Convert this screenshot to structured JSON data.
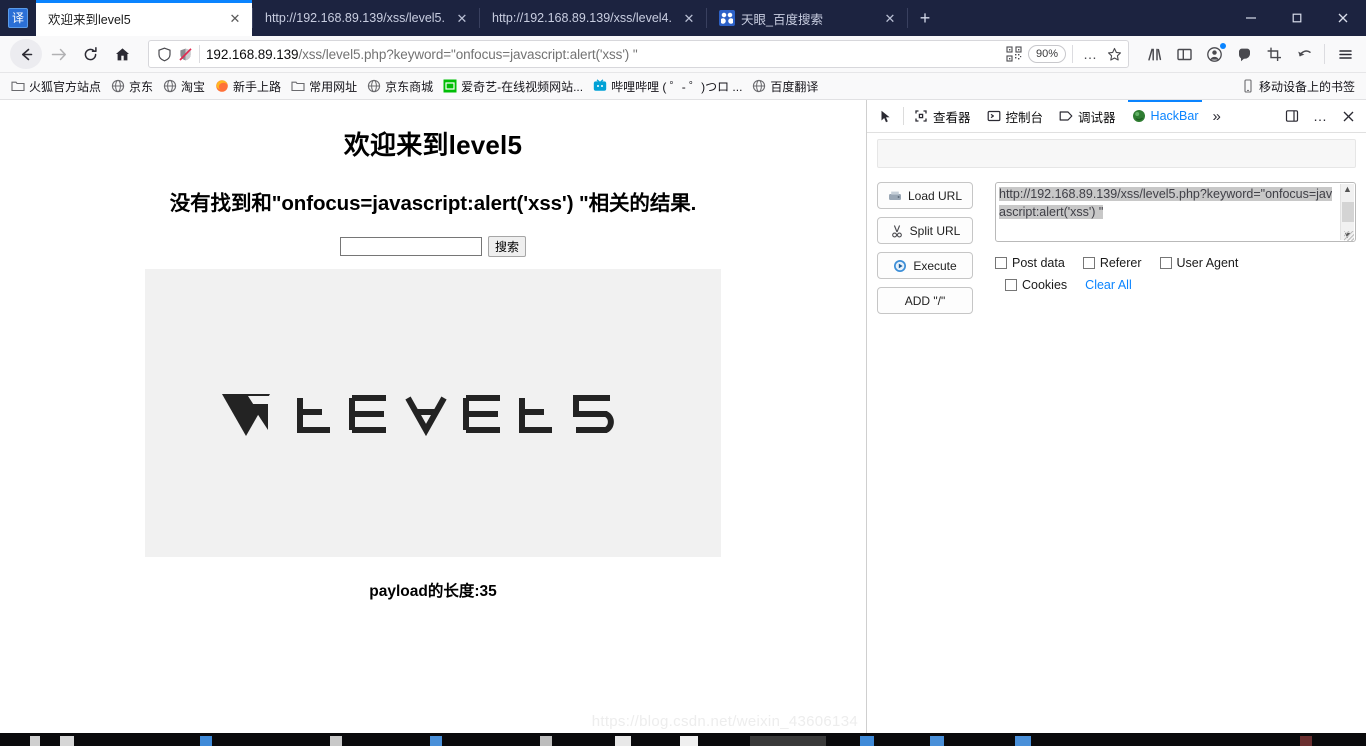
{
  "window": {
    "translate_badge": "译",
    "tabs": [
      {
        "title": "欢迎来到level5",
        "favicon": "none",
        "active": true,
        "close": "✕"
      },
      {
        "title": "http://192.168.89.139/xss/level5.",
        "favicon": "none",
        "active": false,
        "close": "✕"
      },
      {
        "title": "http://192.168.89.139/xss/level4.",
        "favicon": "none",
        "active": false,
        "close": "✕"
      },
      {
        "title": "天眼_百度搜索",
        "favicon": "baidu",
        "active": false,
        "close": "✕"
      }
    ],
    "newtab_label": "+",
    "controls": {
      "minimize": "—",
      "maximize": "❐",
      "close": "✕"
    }
  },
  "nav": {
    "back": "←",
    "forward": "→",
    "reload": "⟳",
    "home": "⌂",
    "url_host": "192.168.89.139",
    "url_path": "/xss/level5.php?keyword=\"onfocus=javascript:alert('xss') \"",
    "zoom_level": "90%",
    "shield_icon": "shield-icon",
    "permission_icon": "blocked-permission-icon",
    "qr_icon": "qr-code-icon",
    "more_icon": "…",
    "star_icon": "☆",
    "library_icon": "library-icon",
    "sidebar_icon": "sidebar-icon",
    "account_icon": "account-icon",
    "pocket_icon": "pocket-icon",
    "screenshot_icon": "screenshot-icon",
    "undo_icon": "↰",
    "menu_icon": "☰"
  },
  "bookmarks": {
    "items": [
      {
        "label": "火狐官方站点",
        "icon": "folder"
      },
      {
        "label": "京东",
        "icon": "globe"
      },
      {
        "label": "淘宝",
        "icon": "globe"
      },
      {
        "label": "新手上路",
        "icon": "firefox"
      },
      {
        "label": "常用网址",
        "icon": "folder"
      },
      {
        "label": "京东商城",
        "icon": "globe"
      },
      {
        "label": "爱奇艺-在线视频网站...",
        "icon": "iqiyi"
      },
      {
        "label": "哔哩哔哩 ( ゜- ゜)つロ ...",
        "icon": "bilibili"
      },
      {
        "label": "百度翻译",
        "icon": "globe"
      }
    ],
    "mobile": {
      "label": "移动设备上的书签",
      "icon": "phone"
    }
  },
  "page": {
    "heading": "欢迎来到level5",
    "subheading": "没有找到和\"onfocus=javascript:alert('xss') \"相关的结果.",
    "search_value": "",
    "search_placeholder": "",
    "search_button": "搜索",
    "logo_text": "LEVEL5",
    "payload_text": "payload的长度:35",
    "watermark": "https://blog.csdn.net/weixin_43606134"
  },
  "devtools": {
    "inspector_picker_icon": "element-picker-icon",
    "tabs": [
      {
        "label": "查看器",
        "icon": "inspector-icon",
        "active": false
      },
      {
        "label": "控制台",
        "icon": "console-icon",
        "active": false
      },
      {
        "label": "调试器",
        "icon": "debugger-icon",
        "active": false
      },
      {
        "label": "HackBar",
        "icon": "hackbar-icon",
        "active": true
      }
    ],
    "overflow": "»",
    "dock_icon": "dock-icon",
    "more_icon": "…",
    "close_icon": "✕",
    "hackbar": {
      "buttons": [
        {
          "label": "Load URL",
          "icon": "load-url-icon"
        },
        {
          "label": "Split URL",
          "icon": "scissors-icon"
        },
        {
          "label": "Execute",
          "icon": "play-icon"
        },
        {
          "label": "ADD \"/\"",
          "icon": "none"
        }
      ],
      "url_value": "http://192.168.89.139/xss/level5.php?keyword=\"onfocus=javascript:alert('xss') \"",
      "checkboxes": [
        {
          "label": "Post data",
          "checked": false
        },
        {
          "label": "Referer",
          "checked": false
        },
        {
          "label": "User Agent",
          "checked": false
        },
        {
          "label": "Cookies",
          "checked": false
        }
      ],
      "clear_all": "Clear All"
    }
  },
  "colors": {
    "tabstrip_bg": "#1c2340",
    "accent": "#0a84ff",
    "chrome_bg": "#f9f9fa",
    "logo_box_bg": "#f1f1f1",
    "logo_dark": "#232323"
  }
}
